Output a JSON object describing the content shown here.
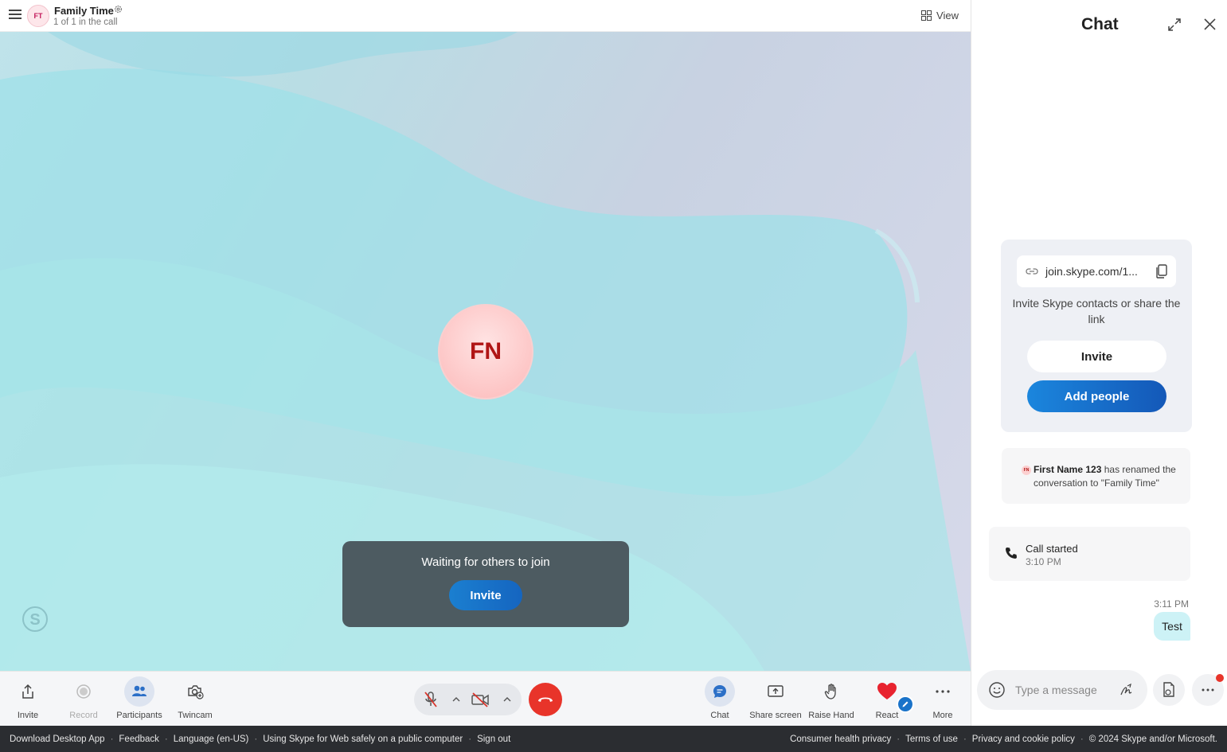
{
  "header": {
    "avatar_initials": "FT",
    "title": "Family Time",
    "subtitle": "1 of 1 in the call",
    "view_label": "View"
  },
  "stage": {
    "participant_initials": "FN",
    "waiting_text": "Waiting for others to join",
    "invite_label": "Invite"
  },
  "toolbar": {
    "invite": "Invite",
    "record": "Record",
    "participants": "Participants",
    "twincam": "Twincam",
    "chat": "Chat",
    "share_screen": "Share screen",
    "raise_hand": "Raise Hand",
    "react": "React",
    "more": "More"
  },
  "chat": {
    "title": "Chat",
    "invite_card": {
      "link": "join.skype.com/1...",
      "description": "Invite Skype contacts or share the link",
      "invite_label": "Invite",
      "add_people_label": "Add people"
    },
    "rename_notice": {
      "avatar_initials": "FN",
      "actor": "First Name 123",
      "text": "has renamed the conversation to \"Family Time\""
    },
    "call_event": {
      "title": "Call started",
      "time": "3:10 PM"
    },
    "message": {
      "time": "3:11 PM",
      "text": "Test"
    },
    "compose_placeholder": "Type a message"
  },
  "footer": {
    "left_links": [
      "Download Desktop App",
      "Feedback",
      "Language (en-US)",
      "Using Skype for Web safely on a public computer",
      "Sign out"
    ],
    "right_links": [
      "Consumer health privacy",
      "Terms of use",
      "Privacy and cookie policy",
      "© 2024 Skype and/or Microsoft."
    ]
  },
  "colors": {
    "accent": "#1565c0",
    "hangup": "#e8342a",
    "footer_bg": "#2b2d31",
    "message_bubble": "#cdf2f6"
  }
}
